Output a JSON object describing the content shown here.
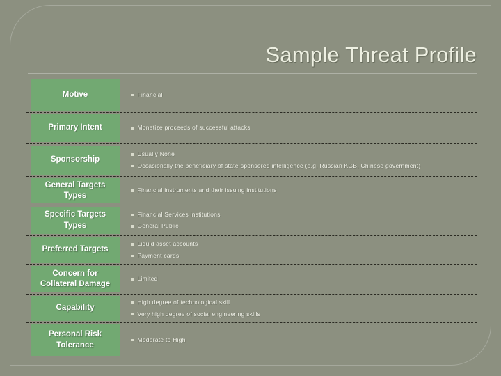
{
  "slide": {
    "title": "Sample Threat Profile",
    "bullet_icon": "square-bullet-icon",
    "accent_color": "#72a972",
    "background_color": "#8c9080",
    "text_color": "#f2f3ea"
  },
  "rows": [
    {
      "label": "Motive",
      "bullets": [
        "Financial"
      ]
    },
    {
      "label": "Primary Intent",
      "bullets": [
        "Monetize proceeds of successful attacks"
      ]
    },
    {
      "label": "Sponsorship",
      "bullets": [
        "Usually None",
        "Occasionally the beneficiary of state-sponsored intelligence (e.g. Russian KGB, Chinese government)"
      ]
    },
    {
      "label": "General Targets Types",
      "bullets": [
        "Financial instruments and their issuing institutions"
      ]
    },
    {
      "label": "Specific Targets Types",
      "bullets": [
        "Financial Services institutions",
        "General Public"
      ]
    },
    {
      "label": "Preferred Targets",
      "bullets": [
        "Liquid asset accounts",
        "Payment cards"
      ]
    },
    {
      "label": "Concern for Collateral Damage",
      "bullets": [
        "Limited"
      ]
    },
    {
      "label": "Capability",
      "bullets": [
        "High degree of technological skill",
        "Very high degree of social engineering skills"
      ]
    },
    {
      "label": "Personal Risk Tolerance",
      "bullets": [
        "Moderate to High"
      ]
    }
  ]
}
